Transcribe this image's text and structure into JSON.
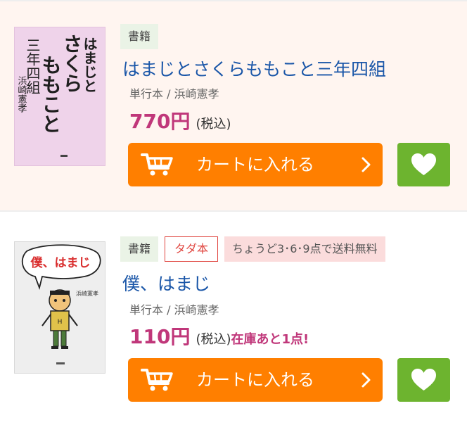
{
  "items": [
    {
      "badges": [
        "書籍"
      ],
      "title": "はまじとさくらももこと三年四組",
      "meta": "単行本 / 浜崎憲孝",
      "price": "770円",
      "tax": "(税込)",
      "stock": "",
      "cover": {
        "title_lines": [
          "はまじと",
          "さくら",
          "ももこと",
          "三年四組"
        ],
        "author": "浜崎憲孝",
        "colors": {
          "bg": "#efd3ea",
          "text": "#1f1f1f"
        }
      },
      "cart_label": "カートに入れる"
    },
    {
      "badges": [
        "書籍",
        "タダ本",
        "ちょうど3･6･9点で送料無料"
      ],
      "title": "僕、はまじ",
      "meta": "単行本 / 浜崎憲孝",
      "price": "110円",
      "tax": "(税込)",
      "stock": "在庫あと1点!",
      "cover": {
        "title_lines": [
          "僕、はまじ"
        ],
        "author": "浜崎憲孝",
        "colors": {
          "bg": "#eeeeee",
          "text": "#d92d2d"
        }
      },
      "cart_label": "カートに入れる"
    }
  ],
  "colors": {
    "accent_orange": "#ff7f00",
    "favorite_green": "#6db42f",
    "title_blue": "#1a56a8",
    "price_pink": "#c0377a",
    "first_row_bg": "#fff5f0"
  },
  "icons": {
    "cart": "cart-icon",
    "chevron": "chevron-right-icon",
    "favorite": "heart-icon"
  }
}
